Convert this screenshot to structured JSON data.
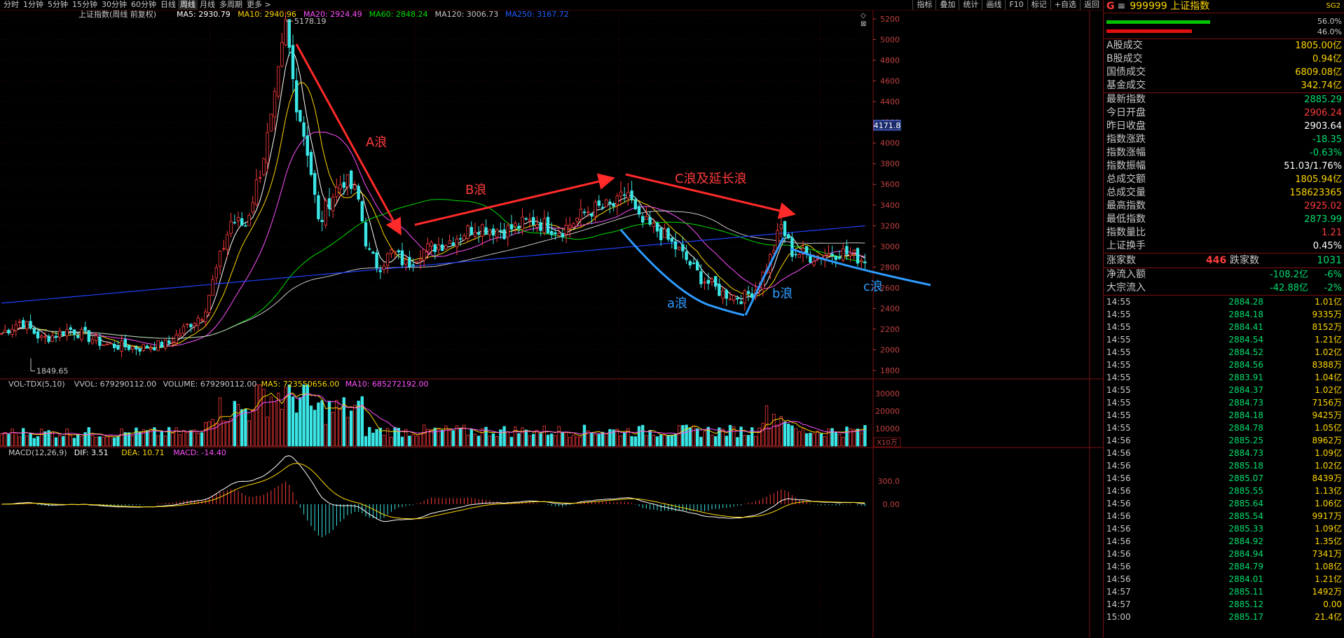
{
  "toolbar": {
    "periods": [
      "分时",
      "1分钟",
      "5分钟",
      "15分钟",
      "30分钟",
      "60分钟",
      "日线",
      "周线",
      "月线",
      "多周期",
      "更多 >"
    ],
    "active_period": "周线",
    "tools": [
      "指标",
      "叠加",
      "统计",
      "画线",
      "F10",
      "标记",
      "+自选",
      "返回"
    ]
  },
  "main_legend": {
    "title": "上证指数(周线 前复权)",
    "items": [
      {
        "label": "MA5: 2930.79",
        "color": "#ffffff"
      },
      {
        "label": "MA10: 2940.96",
        "color": "#ffd700"
      },
      {
        "label": "MA20: 2924.49",
        "color": "#ff50ff"
      },
      {
        "label": "MA60: 2848.24",
        "color": "#00e000"
      },
      {
        "label": "MA120: 3006.73",
        "color": "#c8c8c8"
      },
      {
        "label": "MA250: 3167.72",
        "color": "#2060ff"
      }
    ]
  },
  "vol_legend": {
    "items": [
      {
        "label": "VOL-TDX(5,10)",
        "color": "#c8c8c8"
      },
      {
        "label": "VVOL: 679290112.00",
        "color": "#c8c8c8"
      },
      {
        "label": "VOLUME: 679290112.00",
        "color": "#c8c8c8"
      },
      {
        "label": "MA5: 723550656.00",
        "color": "#ffd700"
      },
      {
        "label": "MA10: 685272192.00",
        "color": "#ff50ff"
      }
    ],
    "unit": "X10万"
  },
  "macd_legend": {
    "items": [
      {
        "label": "MACD(12,26,9)",
        "color": "#c8c8c8"
      },
      {
        "label": "DIF: 3.51",
        "color": "#ffffff"
      },
      {
        "label": "DEA: 10.71",
        "color": "#ffd700"
      },
      {
        "label": "MACD: -14.40",
        "color": "#ff50ff"
      }
    ]
  },
  "chart_data": {
    "type": "candlestick",
    "price_axis": {
      "min": 1800,
      "max": 5200,
      "ticks": [
        5200,
        5000,
        4800,
        4600,
        4400,
        4200,
        4000,
        3800,
        3600,
        3400,
        3200,
        3000,
        2800,
        2600,
        2400,
        2200,
        2000,
        1800
      ],
      "tick_labels": [
        "5200",
        "5000",
        "4800",
        "4600",
        "4400",
        "4200",
        "4000",
        "3800",
        "3600",
        "3400",
        "3200",
        "3000",
        "2800",
        "2600",
        "2400",
        "2200",
        "2000",
        "1800"
      ]
    },
    "crosshair_value": "4171.8",
    "volume_axis": {
      "ticks": [
        30000,
        20000,
        10000
      ],
      "tick_labels": [
        "30000",
        "20000",
        "10000"
      ]
    },
    "macd_axis": {
      "ticks": [
        300,
        0
      ],
      "tick_labels": [
        "300.0",
        "0.00"
      ]
    },
    "high_label": "5178.19",
    "low_label": "1849.65",
    "annotations": {
      "wave_A": "A浪",
      "wave_B": "B浪",
      "wave_C": "C浪及延长浪",
      "wave_a": "a浪",
      "wave_b": "b浪",
      "wave_c": "c浪"
    }
  },
  "panel": {
    "symbol_prefix": "G",
    "code_name": "999999 上证指数",
    "tag": "SG2",
    "bar1_pct": "56.0%",
    "bar2_pct": "46.0%",
    "stats": [
      {
        "label": "A股成交",
        "value": "1805.00亿",
        "color": "#ffd700"
      },
      {
        "label": "B股成交",
        "value": "0.94亿",
        "color": "#ffd700"
      },
      {
        "label": "国债成交",
        "value": "6809.08亿",
        "color": "#ffd700"
      },
      {
        "label": "基金成交",
        "value": "342.74亿",
        "color": "#ffd700"
      }
    ],
    "quote": [
      {
        "label": "最新指数",
        "value": "2885.29",
        "color": "#00e070"
      },
      {
        "label": "今日开盘",
        "value": "2906.24",
        "color": "#ff3b3b"
      },
      {
        "label": "昨日收盘",
        "value": "2903.64",
        "color": "#ffffff"
      },
      {
        "label": "指数涨跌",
        "value": "-18.35",
        "color": "#00e070"
      },
      {
        "label": "指数涨幅",
        "value": "-0.63%",
        "color": "#00e070"
      },
      {
        "label": "指数振幅",
        "value": "51.03/1.76%",
        "color": "#ffffff"
      },
      {
        "label": "总成交额",
        "value": "1805.94亿",
        "color": "#ffd700"
      },
      {
        "label": "总成交量",
        "value": "158623365",
        "color": "#ffd700"
      },
      {
        "label": "最高指数",
        "value": "2925.02",
        "color": "#ff3b3b"
      },
      {
        "label": "最低指数",
        "value": "2873.99",
        "color": "#00e070"
      },
      {
        "label": "指数量比",
        "value": "1.21",
        "color": "#ff3b3b"
      },
      {
        "label": "上证换手",
        "value": "0.45%",
        "color": "#ffffff"
      }
    ],
    "up_label": "涨家数",
    "up_count": "446",
    "down_label": "跌家数",
    "down_count": "1031",
    "flows": [
      {
        "label": "净流入额",
        "value": "-108.2亿",
        "pct": "-6%"
      },
      {
        "label": "大宗流入",
        "value": "-42.88亿",
        "pct": "-2%"
      }
    ],
    "ticks": [
      {
        "t": "14:55",
        "p": "2884.28",
        "v": "1.01亿"
      },
      {
        "t": "14:55",
        "p": "2884.18",
        "v": "9335万"
      },
      {
        "t": "14:55",
        "p": "2884.41",
        "v": "8152万"
      },
      {
        "t": "14:55",
        "p": "2884.54",
        "v": "1.21亿"
      },
      {
        "t": "14:55",
        "p": "2884.52",
        "v": "1.02亿"
      },
      {
        "t": "14:55",
        "p": "2884.56",
        "v": "8388万"
      },
      {
        "t": "14:55",
        "p": "2883.91",
        "v": "1.04亿"
      },
      {
        "t": "14:55",
        "p": "2884.37",
        "v": "1.02亿"
      },
      {
        "t": "14:55",
        "p": "2884.73",
        "v": "7156万"
      },
      {
        "t": "14:55",
        "p": "2884.18",
        "v": "9425万"
      },
      {
        "t": "14:55",
        "p": "2884.78",
        "v": "1.05亿"
      },
      {
        "t": "14:56",
        "p": "2885.25",
        "v": "8962万"
      },
      {
        "t": "14:56",
        "p": "2884.73",
        "v": "1.09亿"
      },
      {
        "t": "14:56",
        "p": "2885.18",
        "v": "1.02亿"
      },
      {
        "t": "14:56",
        "p": "2885.07",
        "v": "8439万"
      },
      {
        "t": "14:56",
        "p": "2885.55",
        "v": "1.13亿"
      },
      {
        "t": "14:56",
        "p": "2885.64",
        "v": "1.06亿"
      },
      {
        "t": "14:56",
        "p": "2885.54",
        "v": "9917万"
      },
      {
        "t": "14:56",
        "p": "2885.33",
        "v": "1.09亿"
      },
      {
        "t": "14:56",
        "p": "2884.92",
        "v": "1.35亿"
      },
      {
        "t": "14:56",
        "p": "2884.94",
        "v": "7341万"
      },
      {
        "t": "14:56",
        "p": "2884.79",
        "v": "1.08亿"
      },
      {
        "t": "14:56",
        "p": "2884.01",
        "v": "1.21亿"
      },
      {
        "t": "14:57",
        "p": "2885.11",
        "v": "1492万"
      },
      {
        "t": "14:57",
        "p": "2885.12",
        "v": "0.00"
      },
      {
        "t": "15:00",
        "p": "2885.17",
        "v": "21.4亿"
      }
    ]
  }
}
